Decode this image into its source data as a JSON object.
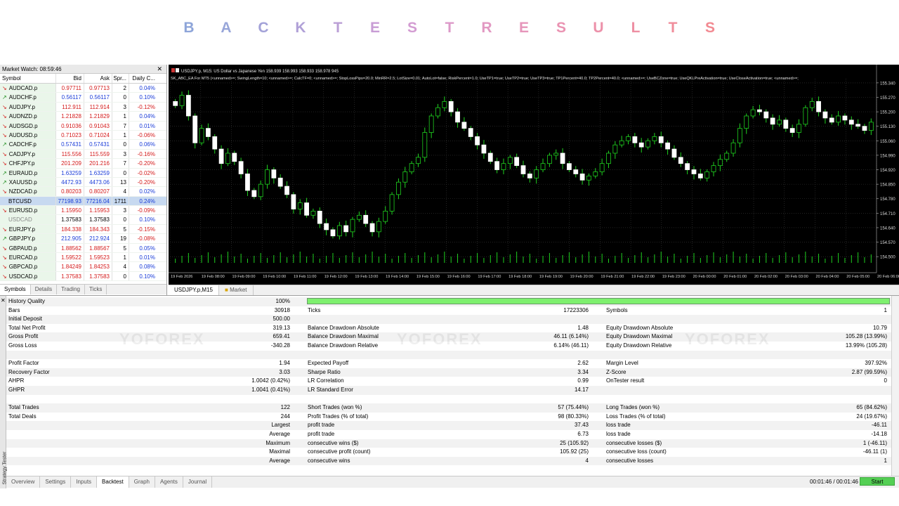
{
  "banner": {
    "letters": [
      "B",
      "A",
      "C",
      "K",
      "T",
      "E",
      "S",
      "T",
      "R",
      "E",
      "S",
      "U",
      "L",
      "T",
      "S"
    ],
    "colors": [
      "#8ea5d9",
      "#98a6d9",
      "#a3a2d8",
      "#b0a0d7",
      "#bb9fd6",
      "#c89dd5",
      "#d39cd2",
      "#dd9ac9",
      "#e298c2",
      "#e696bb",
      "#ea93b2",
      "#ec91aa",
      "#ee8fa3",
      "#f08d9b",
      "#f28a92"
    ]
  },
  "market_watch": {
    "title": "Market Watch: 08:59:46",
    "headers": {
      "symbol": "Symbol",
      "bid": "Bid",
      "ask": "Ask",
      "spread": "Spr...",
      "change": "Daily C..."
    },
    "rows": [
      {
        "symbol": "AUDCAD.p",
        "bid": "0.97711",
        "ask": "0.97713",
        "spread": "2",
        "change": "0.04%",
        "dir": "down",
        "chg": "pos",
        "arrow": "down"
      },
      {
        "symbol": "AUDCHF.p",
        "bid": "0.56117",
        "ask": "0.56117",
        "spread": "0",
        "change": "0.10%",
        "dir": "up",
        "chg": "pos",
        "arrow": "up"
      },
      {
        "symbol": "AUDJPY.p",
        "bid": "112.911",
        "ask": "112.914",
        "spread": "3",
        "change": "-0.12%",
        "dir": "down",
        "chg": "neg",
        "arrow": "down"
      },
      {
        "symbol": "AUDNZD.p",
        "bid": "1.21828",
        "ask": "1.21829",
        "spread": "1",
        "change": "0.04%",
        "dir": "down",
        "chg": "pos",
        "arrow": "down"
      },
      {
        "symbol": "AUDSGD.p",
        "bid": "0.91036",
        "ask": "0.91043",
        "spread": "7",
        "change": "0.01%",
        "dir": "down",
        "chg": "pos",
        "arrow": "down"
      },
      {
        "symbol": "AUDUSD.p",
        "bid": "0.71023",
        "ask": "0.71024",
        "spread": "1",
        "change": "-0.06%",
        "dir": "down",
        "chg": "neg",
        "arrow": "down"
      },
      {
        "symbol": "CADCHF.p",
        "bid": "0.57431",
        "ask": "0.57431",
        "spread": "0",
        "change": "0.06%",
        "dir": "up",
        "chg": "pos",
        "arrow": "up"
      },
      {
        "symbol": "CADJPY.p",
        "bid": "115.556",
        "ask": "115.559",
        "spread": "3",
        "change": "-0.16%",
        "dir": "down",
        "chg": "neg",
        "arrow": "down"
      },
      {
        "symbol": "CHFJPY.p",
        "bid": "201.209",
        "ask": "201.216",
        "spread": "7",
        "change": "-0.20%",
        "dir": "down",
        "chg": "neg",
        "arrow": "down"
      },
      {
        "symbol": "EURAUD.p",
        "bid": "1.63259",
        "ask": "1.63259",
        "spread": "0",
        "change": "-0.02%",
        "dir": "up",
        "chg": "neg",
        "arrow": "up"
      },
      {
        "symbol": "XAUUSD.p",
        "bid": "4472.93",
        "ask": "4473.06",
        "spread": "13",
        "change": "-0.20%",
        "dir": "up",
        "chg": "neg",
        "arrow": "up"
      },
      {
        "symbol": "NZDCAD.p",
        "bid": "0.80203",
        "ask": "0.80207",
        "spread": "4",
        "change": "0.02%",
        "dir": "down",
        "chg": "pos",
        "arrow": "down"
      },
      {
        "symbol": "BTCUSD",
        "bid": "77198.93",
        "ask": "77216.04",
        "spread": "1711",
        "change": "0.24%",
        "dir": "up",
        "chg": "pos",
        "arrow": "none",
        "selected": true
      },
      {
        "symbol": "EURUSD.p",
        "bid": "1.15950",
        "ask": "1.15953",
        "spread": "3",
        "change": "-0.09%",
        "dir": "down",
        "chg": "neg",
        "arrow": "down"
      },
      {
        "symbol": "USDCAD",
        "bid": "1.37583",
        "ask": "1.37583",
        "spread": "0",
        "change": "0.10%",
        "dir": "neutral",
        "chg": "pos",
        "arrow": "none",
        "gray": true
      },
      {
        "symbol": "EURJPY.p",
        "bid": "184.338",
        "ask": "184.343",
        "spread": "5",
        "change": "-0.15%",
        "dir": "down",
        "chg": "neg",
        "arrow": "down"
      },
      {
        "symbol": "GBPJPY.p",
        "bid": "212.905",
        "ask": "212.924",
        "spread": "19",
        "change": "-0.08%",
        "dir": "up",
        "chg": "neg",
        "arrow": "up"
      },
      {
        "symbol": "GBPAUD.p",
        "bid": "1.88562",
        "ask": "1.88567",
        "spread": "5",
        "change": "0.05%",
        "dir": "down",
        "chg": "pos",
        "arrow": "down"
      },
      {
        "symbol": "EURCAD.p",
        "bid": "1.59522",
        "ask": "1.59523",
        "spread": "1",
        "change": "0.01%",
        "dir": "down",
        "chg": "pos",
        "arrow": "down"
      },
      {
        "symbol": "GBPCAD.p",
        "bid": "1.84249",
        "ask": "1.84253",
        "spread": "4",
        "change": "0.08%",
        "dir": "down",
        "chg": "pos",
        "arrow": "down"
      },
      {
        "symbol": "USDCAD.p",
        "bid": "1.37583",
        "ask": "1.37583",
        "spread": "0",
        "change": "0.10%",
        "dir": "down",
        "chg": "pos",
        "arrow": "down"
      }
    ],
    "tabs": [
      "Symbols",
      "Details",
      "Trading",
      "Ticks"
    ]
  },
  "chart": {
    "header1": "USDJPY.p, M15: US Dollar vs Japanese Yen  158.939 158.993 158.933 158.978  945",
    "header2": "SK_ABC_EA For MT5 (<unnamed>=; SwingLength=10; <unnamed>=; CalcTF=0; <unnamed>=; StopLossPips=20.0; MinRR=2.5; LotSize=0.01; AutoLot=false; RiskPercent=1.0; UseTP1=true; UseTP2=true; UseTP3=true; TP1Percent=40.0; TP2Percent=40.0; <unnamed>=; UseBCZone=true; UseQKLPreActivation=true; UseCloseActivation=true; <unnamed>=;",
    "price_labels": [
      "155.340",
      "155.270",
      "155.200",
      "155.130",
      "155.060",
      "154.990",
      "154.920",
      "154.850",
      "154.780",
      "154.710",
      "154.640",
      "154.570",
      "154.500"
    ],
    "time_labels": [
      "19 Feb 2026",
      "19 Feb 08:00",
      "19 Feb 09:00",
      "19 Feb 10:00",
      "19 Feb 11:00",
      "19 Feb 12:00",
      "19 Feb 13:00",
      "19 Feb 14:00",
      "19 Feb 15:00",
      "19 Feb 16:00",
      "19 Feb 17:00",
      "19 Feb 18:00",
      "19 Feb 19:00",
      "19 Feb 20:00",
      "19 Feb 21:00",
      "19 Feb 22:00",
      "19 Feb 23:00",
      "20 Feb 00:00",
      "20 Feb 01:00",
      "20 Feb 02:00",
      "20 Feb 03:00",
      "20 Feb 04:00",
      "20 Feb 05:00",
      "20 Feb 06:00"
    ],
    "tabs": [
      "USDJPY.p,M15",
      "Market"
    ],
    "candles": [
      155.23,
      155.28,
      155.18,
      155.05,
      155.12,
      155.08,
      155.02,
      154.95,
      155.0,
      154.96,
      154.9,
      154.82,
      154.79,
      154.85,
      154.92,
      154.88,
      154.84,
      154.8,
      154.73,
      154.76,
      154.7,
      154.72,
      154.66,
      154.63,
      154.6,
      154.65,
      154.62,
      154.68,
      154.7,
      154.66,
      154.62,
      154.67,
      154.72,
      154.8,
      154.86,
      154.91,
      154.95,
      154.98,
      155.1,
      155.18,
      155.22,
      155.25,
      155.2,
      155.15,
      155.12,
      155.08,
      155.04,
      155.0,
      154.96,
      154.92,
      154.95,
      154.98,
      154.94,
      154.9,
      154.88,
      154.92,
      154.95,
      154.99,
      155.0,
      154.95,
      154.92,
      154.9,
      154.87,
      154.89,
      154.91,
      154.95,
      155.0,
      155.04,
      155.06,
      155.08,
      155.05,
      155.03,
      155.06,
      155.08,
      155.05,
      155.02,
      154.98,
      154.95,
      154.92,
      154.9,
      154.88,
      154.91,
      154.94,
      154.97,
      155.0,
      155.05,
      155.12,
      155.18,
      155.21,
      155.2,
      155.17,
      155.14,
      155.16,
      155.12,
      155.1,
      155.14,
      155.22,
      155.25,
      155.2,
      155.17,
      155.15,
      155.18,
      155.16,
      155.14,
      155.13,
      155.11,
      155.15
    ],
    "price_min": 154.47,
    "price_max": 155.36
  },
  "tester": {
    "side_label": "Strategy Tester",
    "rows": [
      {
        "l1": "History Quality",
        "v1": "100%",
        "l2": "",
        "v2": "",
        "l3": "",
        "v3": "",
        "bar": true,
        "shade": true
      },
      {
        "l1": "Bars",
        "v1": "30918",
        "l2": "Ticks",
        "v2": "17223306",
        "l3": "Symbols",
        "v3": "1"
      },
      {
        "l1": "Initial Deposit",
        "v1": "500.00",
        "l2": "",
        "v2": "",
        "l3": "",
        "v3": "",
        "shade": true
      },
      {
        "l1": "Total Net Profit",
        "v1": "319.13",
        "l2": "Balance Drawdown Absolute",
        "v2": "1.48",
        "l3": "Equity Drawdown Absolute",
        "v3": "10.79"
      },
      {
        "l1": "Gross Profit",
        "v1": "659.41",
        "l2": "Balance Drawdown Maximal",
        "v2": "46.11 (6.14%)",
        "l3": "Equity Drawdown Maximal",
        "v3": "105.28 (13.99%)",
        "shade": true
      },
      {
        "l1": "Gross Loss",
        "v1": "-340.28",
        "l2": "Balance Drawdown Relative",
        "v2": "6.14% (46.11)",
        "l3": "Equity Drawdown Relative",
        "v3": "13.99% (105.28)"
      },
      {
        "l1": "",
        "v1": "",
        "l2": "",
        "v2": "",
        "l3": "",
        "v3": "",
        "shade": true
      },
      {
        "l1": "Profit Factor",
        "v1": "1.94",
        "l2": "Expected Payoff",
        "v2": "2.62",
        "l3": "Margin Level",
        "v3": "397.92%"
      },
      {
        "l1": "Recovery Factor",
        "v1": "3.03",
        "l2": "Sharpe Ratio",
        "v2": "3.34",
        "l3": "Z-Score",
        "v3": "2.87 (99.59%)",
        "shade": true
      },
      {
        "l1": "AHPR",
        "v1": "1.0042 (0.42%)",
        "l2": "LR Correlation",
        "v2": "0.99",
        "l3": "OnTester result",
        "v3": "0"
      },
      {
        "l1": "GHPR",
        "v1": "1.0041 (0.41%)",
        "l2": "LR Standard Error",
        "v2": "14.17",
        "l3": "",
        "v3": "",
        "shade": true
      },
      {
        "l1": "",
        "v1": "",
        "l2": "",
        "v2": "",
        "l3": "",
        "v3": ""
      },
      {
        "l1": "Total Trades",
        "v1": "122",
        "l2": "Short Trades (won %)",
        "v2": "57 (75.44%)",
        "l3": "Long Trades (won %)",
        "v3": "65 (84.62%)",
        "shade": true
      },
      {
        "l1": "Total Deals",
        "v1": "244",
        "l2": "Profit Trades (% of total)",
        "v2": "98 (80.33%)",
        "l3": "Loss Trades (% of total)",
        "v3": "24 (19.67%)"
      },
      {
        "l1": "",
        "v1": "Largest",
        "l2": "profit trade",
        "v2": "37.43",
        "l3": "loss trade",
        "v3": "-46.11",
        "shade": true
      },
      {
        "l1": "",
        "v1": "Average",
        "l2": "profit trade",
        "v2": "6.73",
        "l3": "loss trade",
        "v3": "-14.18"
      },
      {
        "l1": "",
        "v1": "Maximum",
        "l2": "consecutive wins ($)",
        "v2": "25 (105.92)",
        "l3": "consecutive losses ($)",
        "v3": "1 (-46.11)",
        "shade": true
      },
      {
        "l1": "",
        "v1": "Maximal",
        "l2": "consecutive profit (count)",
        "v2": "105.92 (25)",
        "l3": "consecutive loss (count)",
        "v3": "-46.11 (1)"
      },
      {
        "l1": "",
        "v1": "Average",
        "l2": "consecutive wins",
        "v2": "4",
        "l3": "consecutive losses",
        "v3": "1",
        "shade": true
      }
    ],
    "tabs": [
      "Overview",
      "Settings",
      "Inputs",
      "Backtest",
      "Graph",
      "Agents",
      "Journal"
    ],
    "active_tab": "Backtest",
    "timer": "00:01:46 / 00:01:46",
    "start_label": "Start"
  },
  "watermark": "YOFOREX"
}
